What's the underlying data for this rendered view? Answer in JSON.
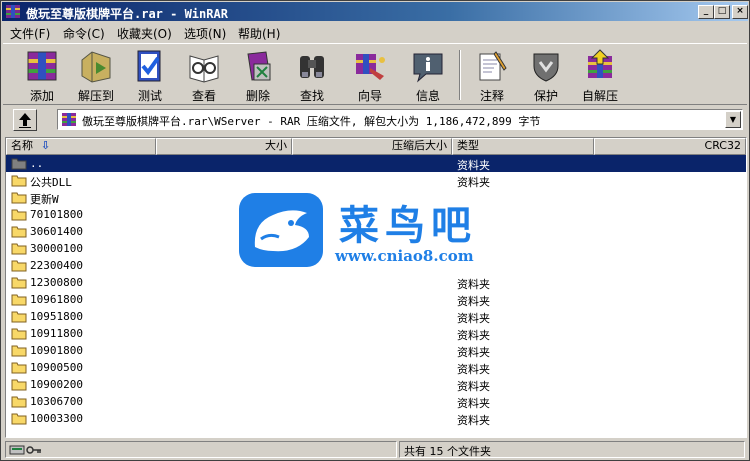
{
  "window": {
    "title": "傲玩至尊版棋牌平台.rar - WinRAR"
  },
  "title_buttons": {
    "minimize": "_",
    "maximize": "□",
    "close": "×"
  },
  "menu": [
    {
      "label": "文件(F)"
    },
    {
      "label": "命令(C)"
    },
    {
      "label": "收藏夹(O)"
    },
    {
      "label": "选项(N)"
    },
    {
      "label": "帮助(H)"
    }
  ],
  "toolbar": [
    {
      "label": "添加",
      "icon": "add-archive-icon"
    },
    {
      "label": "解压到",
      "icon": "extract-to-icon"
    },
    {
      "label": "测试",
      "icon": "test-icon"
    },
    {
      "label": "查看",
      "icon": "view-icon"
    },
    {
      "label": "删除",
      "icon": "delete-icon"
    },
    {
      "label": "查找",
      "icon": "find-icon"
    },
    {
      "label": "向导",
      "icon": "wizard-icon"
    },
    {
      "label": "信息",
      "icon": "info-icon"
    },
    {
      "label": "注释",
      "icon": "comment-icon"
    },
    {
      "label": "保护",
      "icon": "protect-icon"
    },
    {
      "label": "自解压",
      "icon": "sfx-icon"
    }
  ],
  "address": {
    "path": "傲玩至尊版棋牌平台.rar\\WServer - RAR 压缩文件, 解包大小为 1,186,472,899 字节"
  },
  "columns": {
    "name": "名称",
    "size": "大小",
    "packed": "压缩后大小",
    "type": "类型",
    "crc": "CRC32"
  },
  "files": [
    {
      "name": "..",
      "type": "资料夹",
      "selected": true
    },
    {
      "name": "公共DLL",
      "type": "资料夹"
    },
    {
      "name": "更新W",
      "type": ""
    },
    {
      "name": "70101800",
      "type": ""
    },
    {
      "name": "30601400",
      "type": ""
    },
    {
      "name": "30000100",
      "type": ""
    },
    {
      "name": "22300400",
      "type": ""
    },
    {
      "name": "12300800",
      "type": "资料夹"
    },
    {
      "name": "10961800",
      "type": "资料夹"
    },
    {
      "name": "10951800",
      "type": "资料夹"
    },
    {
      "name": "10911800",
      "type": "资料夹"
    },
    {
      "name": "10901800",
      "type": "资料夹"
    },
    {
      "name": "10900500",
      "type": "资料夹"
    },
    {
      "name": "10900200",
      "type": "资料夹"
    },
    {
      "name": "10306700",
      "type": "资料夹"
    },
    {
      "name": "10003300",
      "type": "资料夹"
    }
  ],
  "watermark": {
    "title": "菜鸟吧",
    "url": "www.cniao8.com"
  },
  "status": {
    "left": "",
    "right": "共有 15 个文件夹"
  },
  "colors": {
    "title_start": "#0a246a",
    "title_end": "#a6caf0",
    "selection": "#0a246a",
    "watermark": "#1f7fe6"
  }
}
